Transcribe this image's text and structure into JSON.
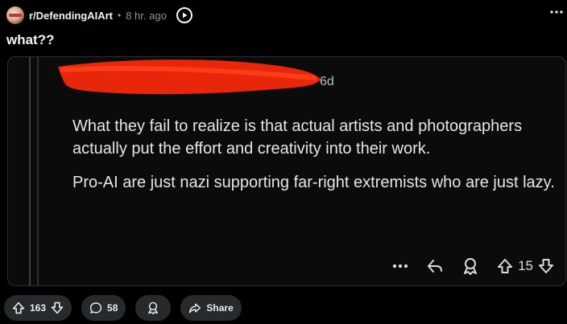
{
  "post": {
    "subreddit": "r/DefendingAIArt",
    "separator": "•",
    "time": "8 hr. ago",
    "title": "what??"
  },
  "comment": {
    "time": "6d",
    "paragraphs": [
      "What they fail to realize is that actual artists and photographers actually put the effort and creativity into their work.",
      "Pro-AI are just nazi supporting far-right extremists who are just lazy."
    ],
    "score": "15"
  },
  "actions": {
    "upvotes": "163",
    "comments": "58",
    "share_label": "Share"
  },
  "colors": {
    "background": "#000000",
    "card": "#0b0b0b",
    "pill": "#272a2c",
    "redaction": "#e8260a",
    "text_muted": "#8b959b"
  },
  "icons": [
    "play-icon",
    "more-icon",
    "reply-icon",
    "award-icon",
    "upvote-icon",
    "downvote-icon",
    "comment-icon",
    "share-icon"
  ]
}
